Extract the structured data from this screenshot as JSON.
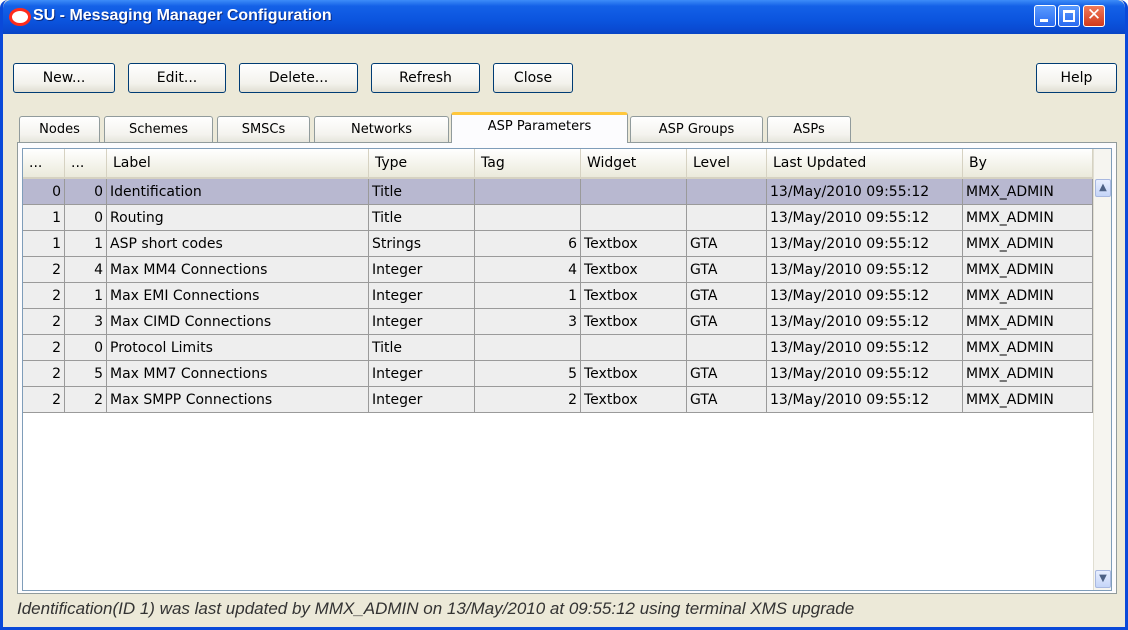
{
  "window": {
    "title": "SU - Messaging Manager Configuration",
    "controls": {
      "minimize": "–",
      "maximize": "□",
      "close": "✕"
    }
  },
  "toolbar": {
    "new_label": "New...",
    "edit_label": "Edit...",
    "delete_label": "Delete...",
    "refresh_label": "Refresh",
    "close_label": "Close",
    "help_label": "Help"
  },
  "tabs": [
    "Nodes",
    "Schemes",
    "SMSCs",
    "Networks",
    "ASP Parameters",
    "ASP Groups",
    "ASPs"
  ],
  "active_tab": "ASP Parameters",
  "table": {
    "columns": [
      "...",
      "...",
      "Label",
      "Type",
      "Tag",
      "Widget",
      "Level",
      "Last Updated",
      "By"
    ],
    "rows": [
      [
        "0",
        "0",
        "Identification",
        "Title",
        "",
        "",
        "",
        "13/May/2010 09:55:12",
        "MMX_ADMIN"
      ],
      [
        "1",
        "0",
        "Routing",
        "Title",
        "",
        "",
        "",
        "13/May/2010 09:55:12",
        "MMX_ADMIN"
      ],
      [
        "1",
        "1",
        "ASP short codes",
        "Strings",
        "6",
        "Textbox",
        "GTA",
        "13/May/2010 09:55:12",
        "MMX_ADMIN"
      ],
      [
        "2",
        "4",
        "Max MM4 Connections",
        "Integer",
        "4",
        "Textbox",
        "GTA",
        "13/May/2010 09:55:12",
        "MMX_ADMIN"
      ],
      [
        "2",
        "1",
        "Max EMI Connections",
        "Integer",
        "1",
        "Textbox",
        "GTA",
        "13/May/2010 09:55:12",
        "MMX_ADMIN"
      ],
      [
        "2",
        "3",
        "Max CIMD Connections",
        "Integer",
        "3",
        "Textbox",
        "GTA",
        "13/May/2010 09:55:12",
        "MMX_ADMIN"
      ],
      [
        "2",
        "0",
        "Protocol Limits",
        "Title",
        "",
        "",
        "",
        "13/May/2010 09:55:12",
        "MMX_ADMIN"
      ],
      [
        "2",
        "5",
        "Max MM7 Connections",
        "Integer",
        "5",
        "Textbox",
        "GTA",
        "13/May/2010 09:55:12",
        "MMX_ADMIN"
      ],
      [
        "2",
        "2",
        "Max SMPP Connections",
        "Integer",
        "2",
        "Textbox",
        "GTA",
        "13/May/2010 09:55:12",
        "MMX_ADMIN"
      ]
    ],
    "selected_row": 0
  },
  "scrollbar": {
    "up": "▲",
    "down": "▼"
  },
  "status_text": "Identification(ID 1) was last updated by MMX_ADMIN on 13/May/2010 at 09:55:12 using terminal XMS upgrade"
}
